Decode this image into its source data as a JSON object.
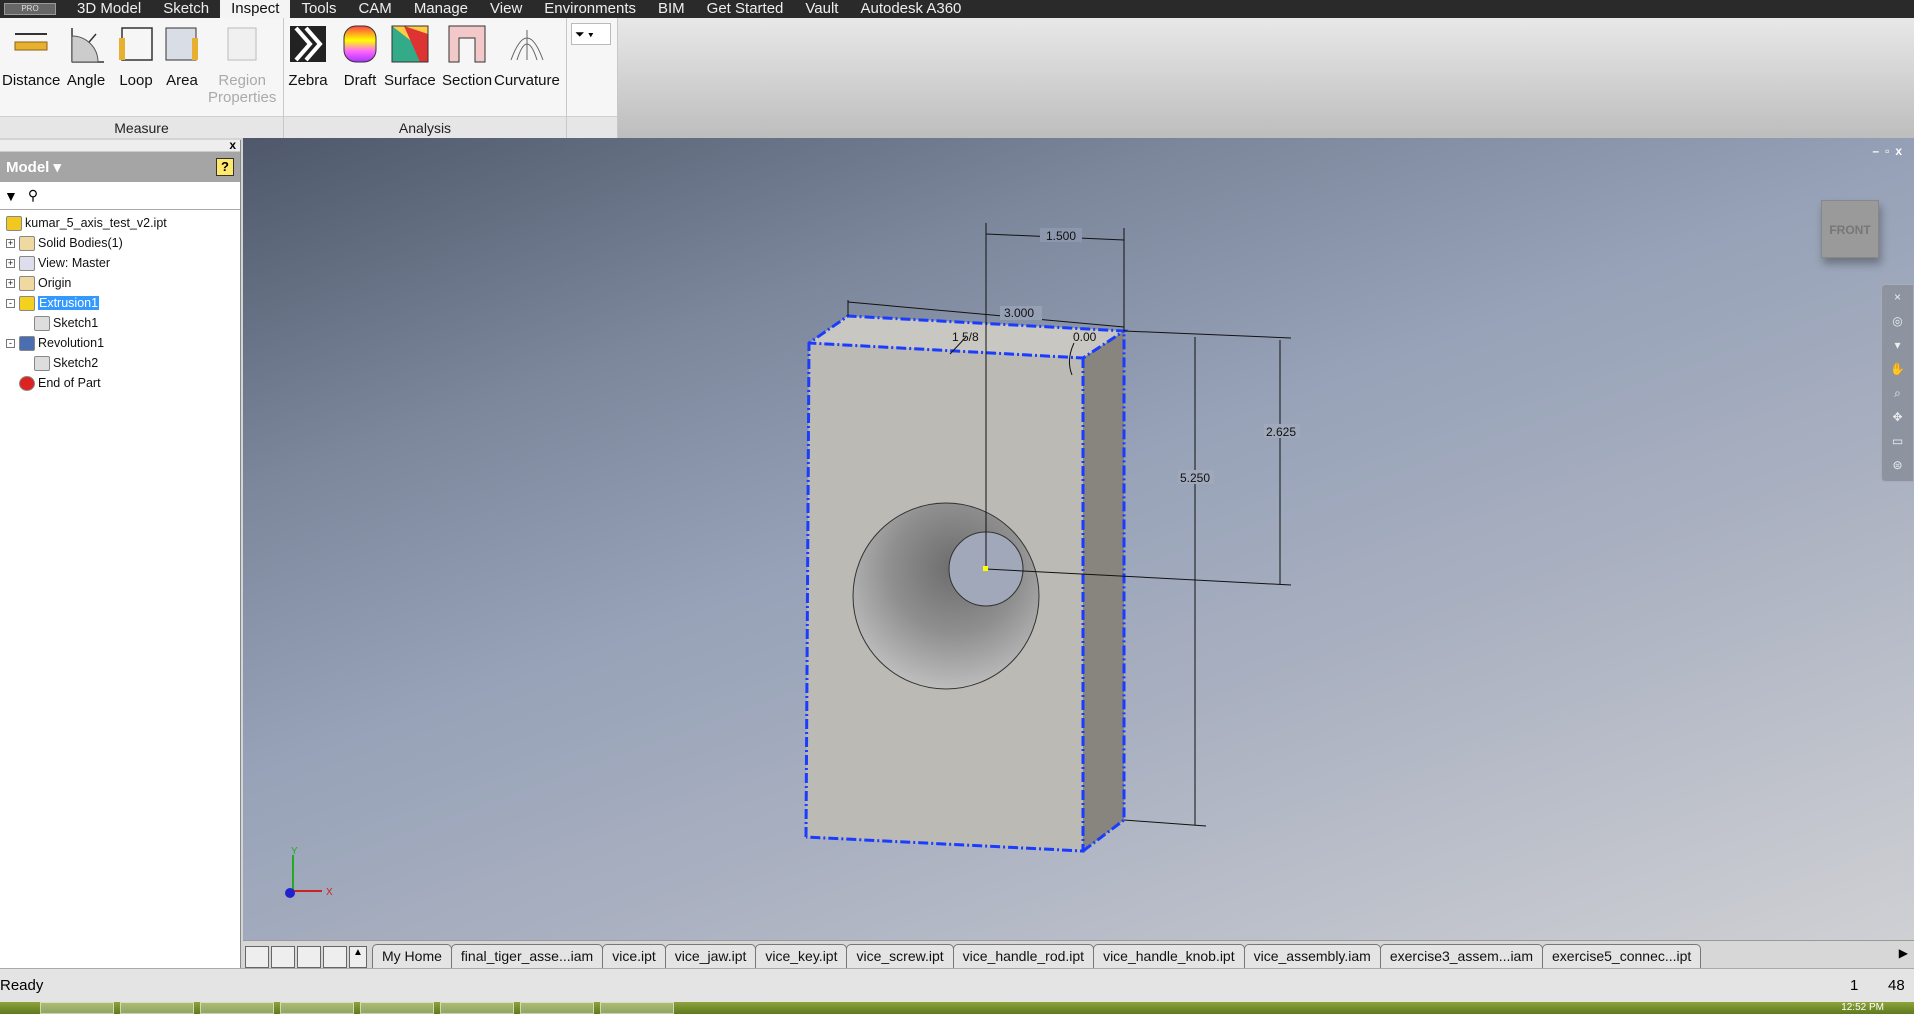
{
  "ribbon_tabs": [
    "3D Model",
    "Sketch",
    "Inspect",
    "Tools",
    "CAM",
    "Manage",
    "View",
    "Environments",
    "BIM",
    "Get Started",
    "Vault",
    "Autodesk A360"
  ],
  "active_tab": "Inspect",
  "measure": {
    "title": "Measure",
    "tools": [
      "Distance",
      "Angle",
      "Loop",
      "Area"
    ],
    "region_line1": "Region",
    "region_line2": "Properties"
  },
  "analysis": {
    "title": "Analysis",
    "tools": [
      "Zebra",
      "Draft",
      "Surface",
      "Section",
      "Curvature"
    ]
  },
  "browser": {
    "title": "Model",
    "help": "?",
    "close": "x",
    "filter_icon": "funnel",
    "find_icon": "binoculars",
    "tree": [
      {
        "label": "kumar_5_axis_test_v2.ipt",
        "icon": "part",
        "expander": ""
      },
      {
        "label": "Solid Bodies(1)",
        "icon": "folder",
        "expander": "+"
      },
      {
        "label": "View: Master",
        "icon": "view",
        "expander": "+"
      },
      {
        "label": "Origin",
        "icon": "folder",
        "expander": "+"
      },
      {
        "label": "Extrusion1",
        "icon": "extrusion",
        "expander": "-",
        "selected": true
      },
      {
        "label": "Sketch1",
        "icon": "sketch",
        "expander": "",
        "child": true
      },
      {
        "label": "Revolution1",
        "icon": "revolution",
        "expander": "-"
      },
      {
        "label": "Sketch2",
        "icon": "sketch",
        "expander": "",
        "child": true
      },
      {
        "label": "End of Part",
        "icon": "end",
        "expander": ""
      }
    ]
  },
  "viewport": {
    "viewcube_label": "FRONT",
    "window_controls": "–▫x",
    "dimensions": {
      "d1": "1.500",
      "d2": "3.000",
      "d3": "1 5/8",
      "d4": "0.00",
      "d5": "5.250",
      "d6": "2.625"
    },
    "axis": {
      "x": "X",
      "y": "Y"
    },
    "highlight_color": "#1a3cff"
  },
  "doc_tabs": [
    "My Home",
    "final_tiger_asse...iam",
    "vice.ipt",
    "vice_jaw.ipt",
    "vice_key.ipt",
    "vice_screw.ipt",
    "vice_handle_rod.ipt",
    "vice_handle_knob.ipt",
    "vice_assembly.iam",
    "exercise3_assem...iam",
    "exercise5_connec...ipt"
  ],
  "status": {
    "text": "Ready",
    "n1": "1",
    "n2": "48"
  },
  "taskbar": {
    "clock": "12:52 PM"
  }
}
